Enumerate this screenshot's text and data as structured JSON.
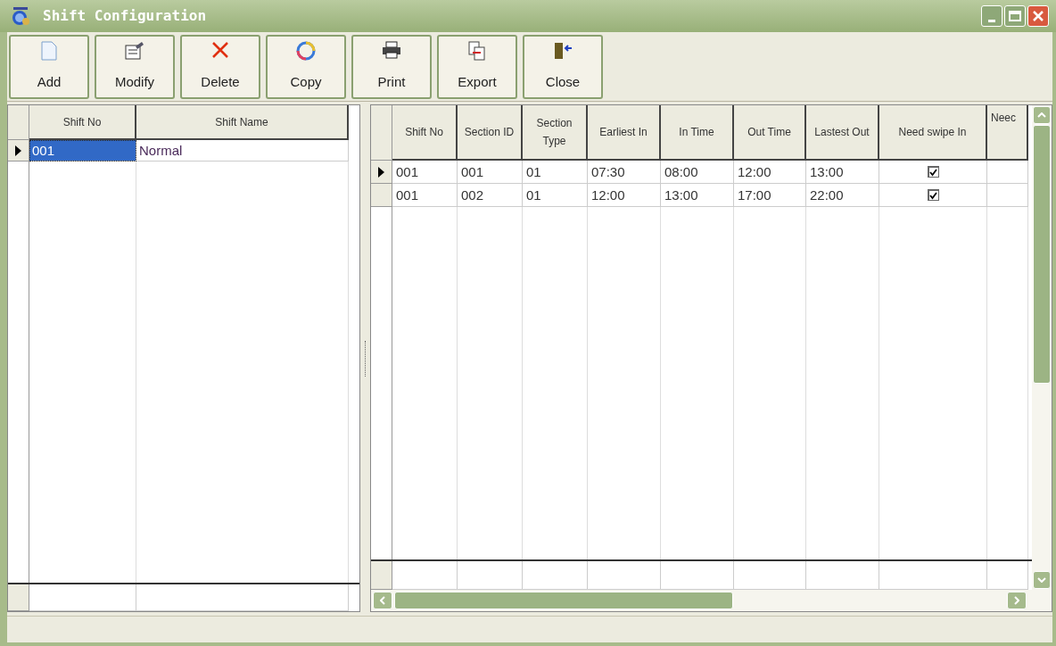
{
  "window": {
    "title": "Shift Configuration"
  },
  "toolbar": [
    {
      "label": "Add",
      "kind": "add"
    },
    {
      "label": "Modify",
      "kind": "modify"
    },
    {
      "label": "Delete",
      "kind": "delete"
    },
    {
      "label": "Copy",
      "kind": "copy"
    },
    {
      "label": "Print",
      "kind": "print"
    },
    {
      "label": "Export",
      "kind": "export"
    },
    {
      "label": "Close",
      "kind": "close"
    }
  ],
  "shift_table": {
    "columns": [
      "Shift No",
      "Shift Name"
    ],
    "rows": [
      {
        "cells": [
          "001",
          "Normal"
        ],
        "selected": true
      }
    ]
  },
  "section_table": {
    "columns": [
      "Shift No",
      "Section ID",
      "Section Type",
      "Earliest In",
      "In Time",
      "Out Time",
      "Lastest Out",
      "Need swipe In",
      "Neec"
    ],
    "rows": [
      {
        "cells": [
          "001",
          "001",
          "01",
          "07:30",
          "08:00",
          "12:00",
          "13:00"
        ],
        "need_swipe_in": true,
        "selected": true
      },
      {
        "cells": [
          "001",
          "002",
          "01",
          "12:00",
          "13:00",
          "17:00",
          "22:00"
        ],
        "need_swipe_in": true,
        "selected": false
      }
    ]
  }
}
